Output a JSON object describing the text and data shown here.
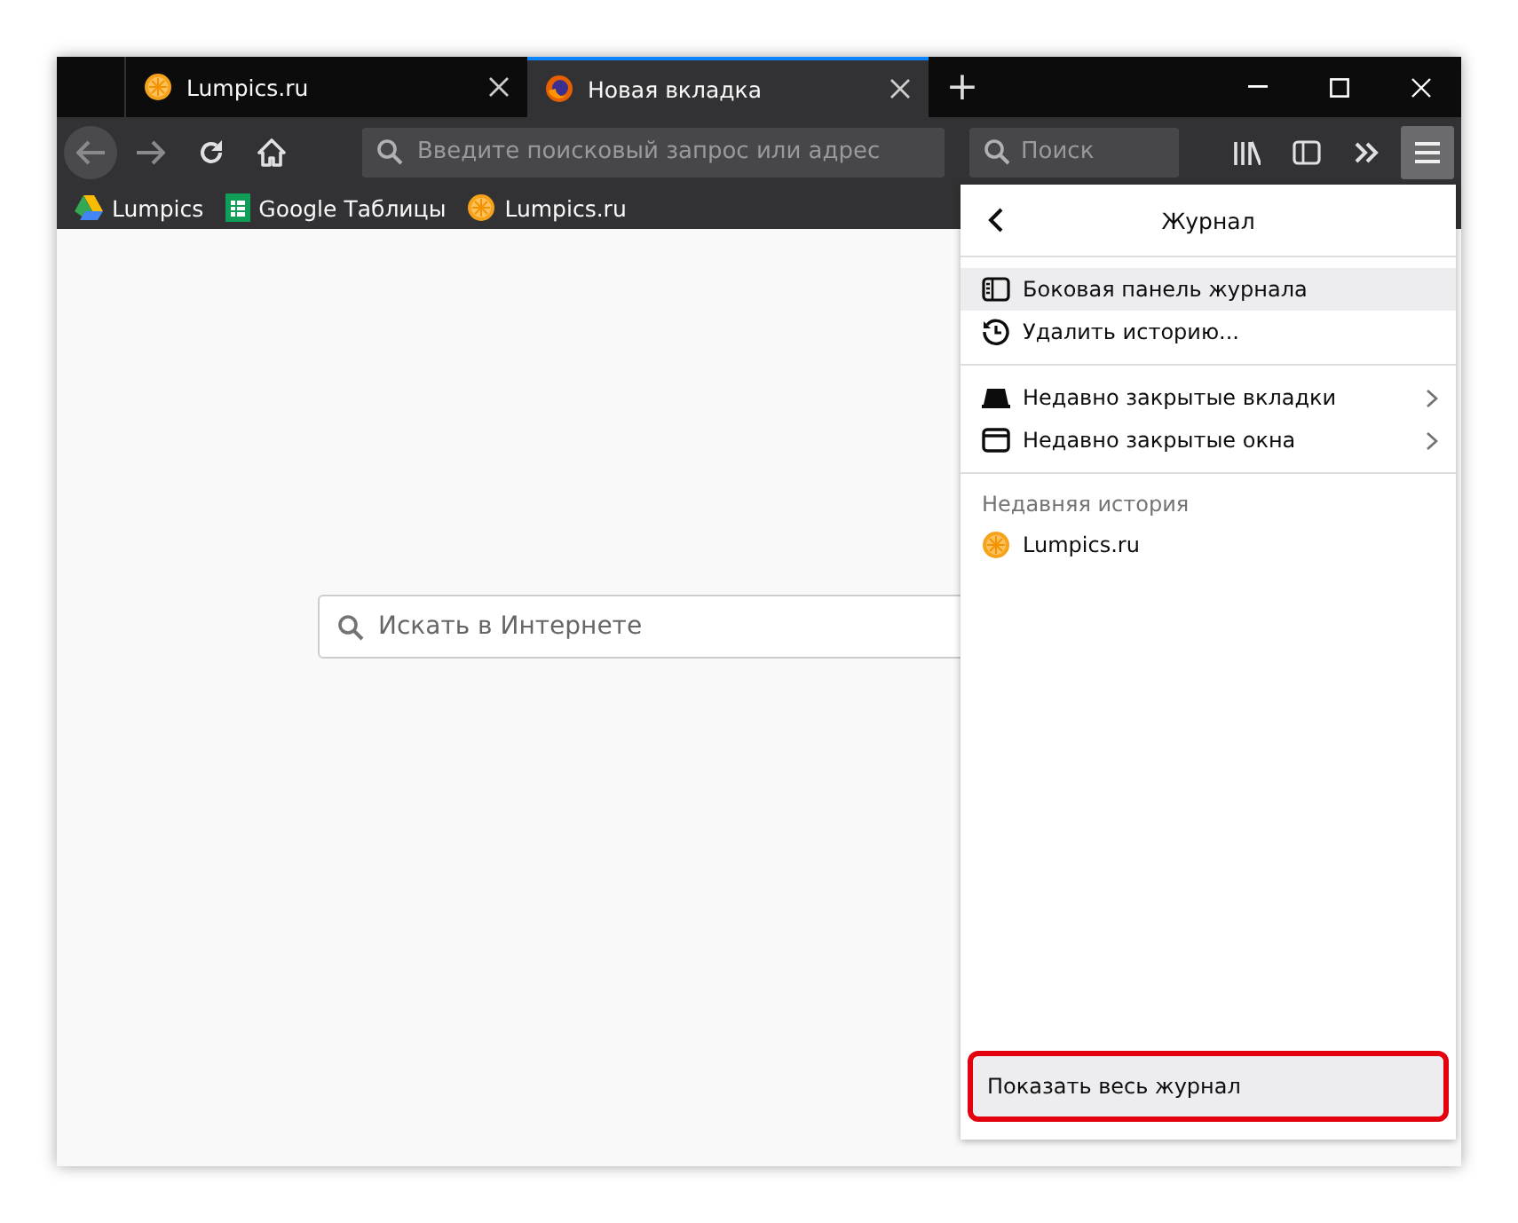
{
  "tabs": [
    {
      "title": "Lumpics.ru",
      "kind": "orange",
      "selected": false
    },
    {
      "title": "Новая вкладка",
      "kind": "firefox",
      "selected": true
    }
  ],
  "new_tab": "+",
  "toolbar": {
    "address_placeholder": "Введите поисковый запрос или адрес",
    "search_placeholder": "Поиск",
    "menu_open": true
  },
  "bookmarks": [
    {
      "label": "Lumpics",
      "kind": "drive"
    },
    {
      "label": "Google Таблицы",
      "kind": "sheets"
    },
    {
      "label": "Lumpics.ru",
      "kind": "orange"
    }
  ],
  "page_search": {
    "placeholder": "Искать в Интернете"
  },
  "menu": {
    "title": "Журнал",
    "groups": [
      [
        {
          "label": "Боковая панель журнала",
          "kind": "sidebar",
          "submenu": false,
          "hovered": true
        },
        {
          "label": "Удалить историю...",
          "kind": "history",
          "submenu": false,
          "hovered": false
        }
      ],
      [
        {
          "label": "Недавно закрытые вкладки",
          "kind": "tab",
          "submenu": true,
          "hovered": false
        },
        {
          "label": "Недавно закрытые окна",
          "kind": "window",
          "submenu": true,
          "hovered": false
        }
      ]
    ],
    "history_heading": "Недавняя история",
    "history": [
      {
        "label": "Lumpics.ru",
        "kind": "orange"
      }
    ],
    "footer": {
      "label": "Показать весь журнал",
      "outlined": true
    }
  }
}
